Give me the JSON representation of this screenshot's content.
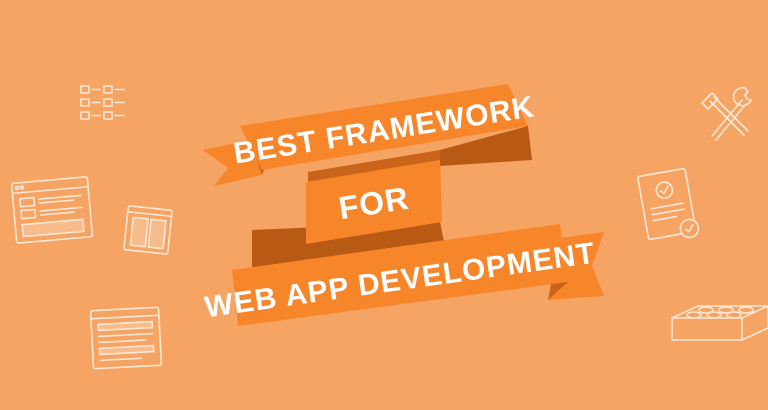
{
  "banner": {
    "line1": "BEST FRAMEWORK",
    "line2": "FOR",
    "line3": "WEB APP DEVELOPMENT"
  },
  "colors": {
    "background": "#F6A464",
    "ribbon": "#F7852A",
    "ribbon_fold": "#C9641A",
    "ribbon_shadow": "#B85A14",
    "outline_icons": "#FFF4EA",
    "text": "#FFFFFF"
  },
  "icons": [
    "grid-list-icon",
    "browser-window-icon",
    "two-column-layout-icon",
    "text-page-icon",
    "tools-icon",
    "certificate-icon",
    "lego-brick-icon"
  ]
}
